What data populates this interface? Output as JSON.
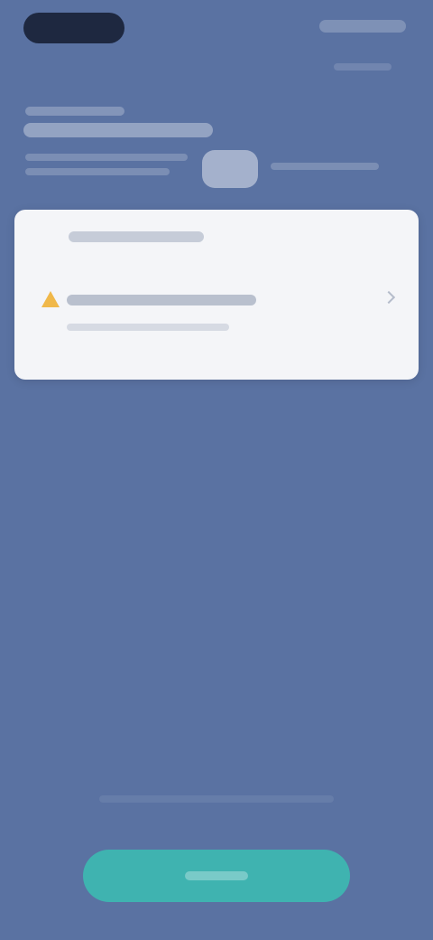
{
  "status_bar": {
    "time": "",
    "indicators": ""
  },
  "header": {
    "eyebrow": "",
    "title": "",
    "info_text": ""
  },
  "card": {
    "title": "",
    "warning_text": "",
    "sub_text": "",
    "warning_icon": "warning-icon",
    "chevron_icon": "chevron-right-icon"
  },
  "footer": {
    "hint": "",
    "primary_button_label": ""
  },
  "colors": {
    "background": "#5a72a2",
    "card": "#f4f5f8",
    "primary_button": "#3fb3b0",
    "warning": "#f0b84a"
  }
}
